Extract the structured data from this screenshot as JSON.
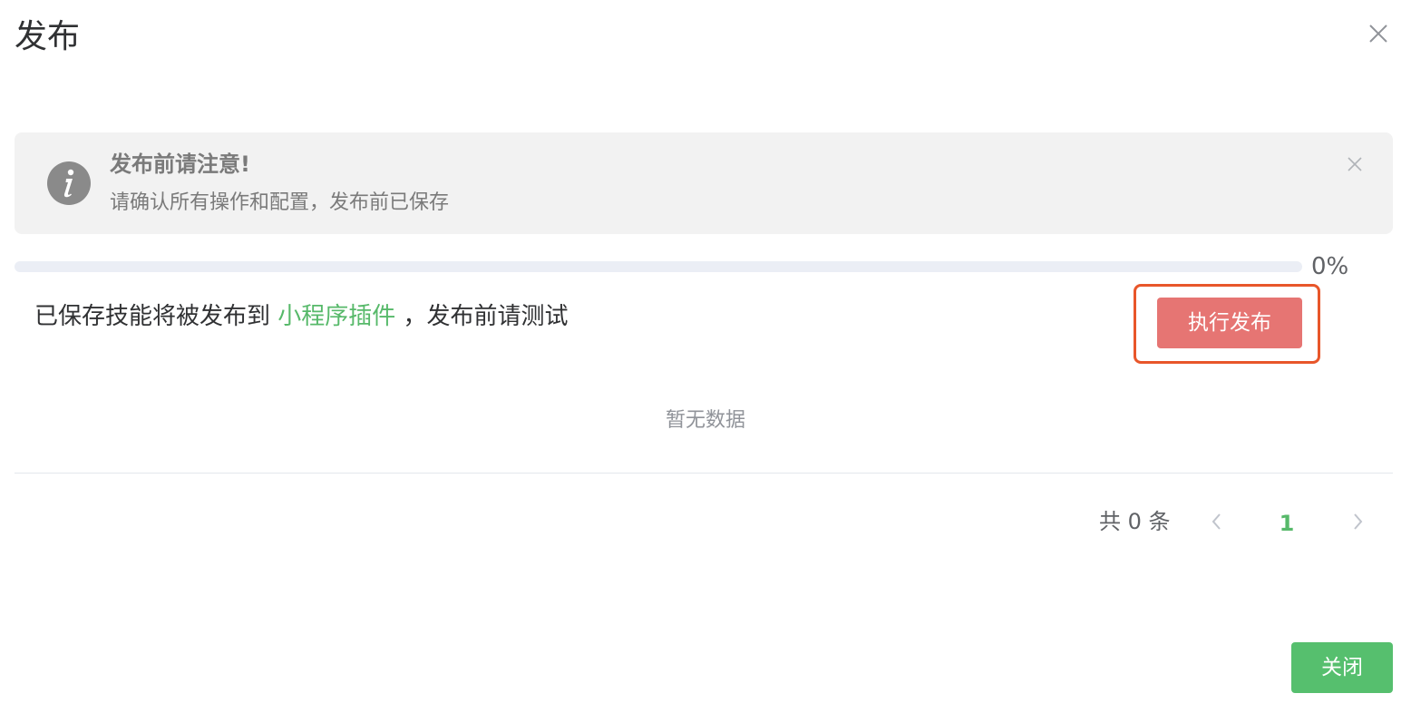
{
  "dialog": {
    "title": "发布"
  },
  "alert": {
    "title": "发布前请注意!",
    "description": "请确认所有操作和配置，发布前已保存",
    "icon": "info-icon"
  },
  "progress": {
    "value": 0,
    "label": "0%"
  },
  "info": {
    "prefix": "已保存技能将被发布到 ",
    "target": "小程序插件",
    "suffix": " ，发布前请测试"
  },
  "actions": {
    "publish_label": "执行发布",
    "close_label": "关闭"
  },
  "table": {
    "empty_text": "暂无数据"
  },
  "pagination": {
    "total_label": "共 0 条",
    "current_page": "1"
  },
  "colors": {
    "accent_green": "#57b96a",
    "publish_button": "#e67573",
    "highlight_border": "#e8562a"
  }
}
